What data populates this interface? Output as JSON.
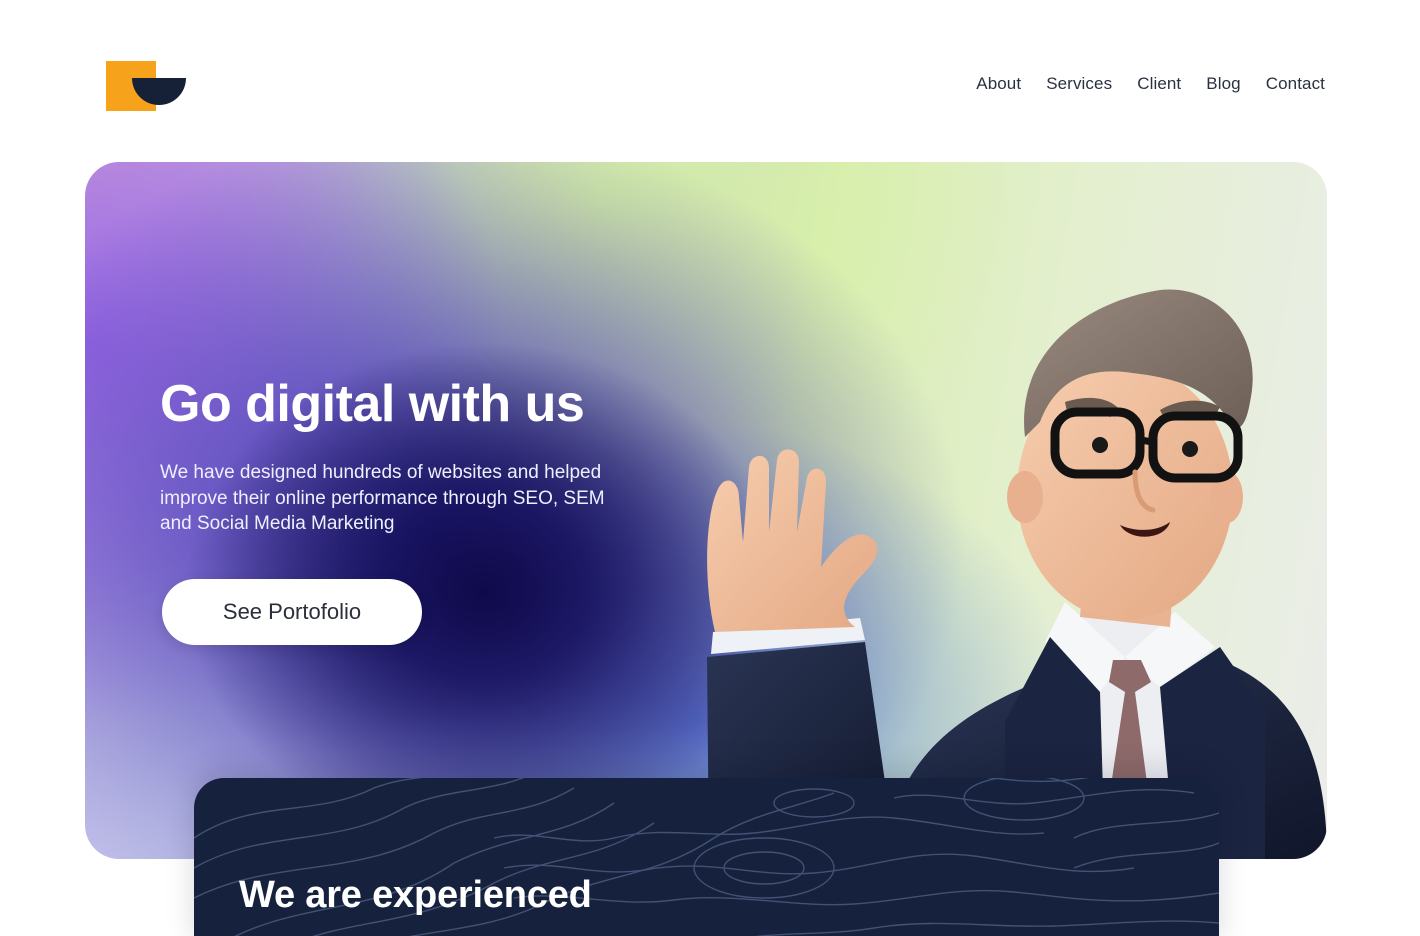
{
  "brand": {
    "logo_icon": "brand-logo-icon",
    "accent": "#f7a21b",
    "dark": "#162036"
  },
  "nav": {
    "items": [
      {
        "label": "About"
      },
      {
        "label": "Services"
      },
      {
        "label": "Client"
      },
      {
        "label": "Blog"
      },
      {
        "label": "Contact"
      }
    ]
  },
  "hero": {
    "title": "Go digital with us",
    "description": "We have designed hundreds of websites and helped improve their online performance through SEO, SEM and Social Media Marketing",
    "cta_label": "See Portofolio",
    "illustration": "waving-businessman-illustration"
  },
  "experience": {
    "title": "We are experienced",
    "background": "#16213d"
  }
}
